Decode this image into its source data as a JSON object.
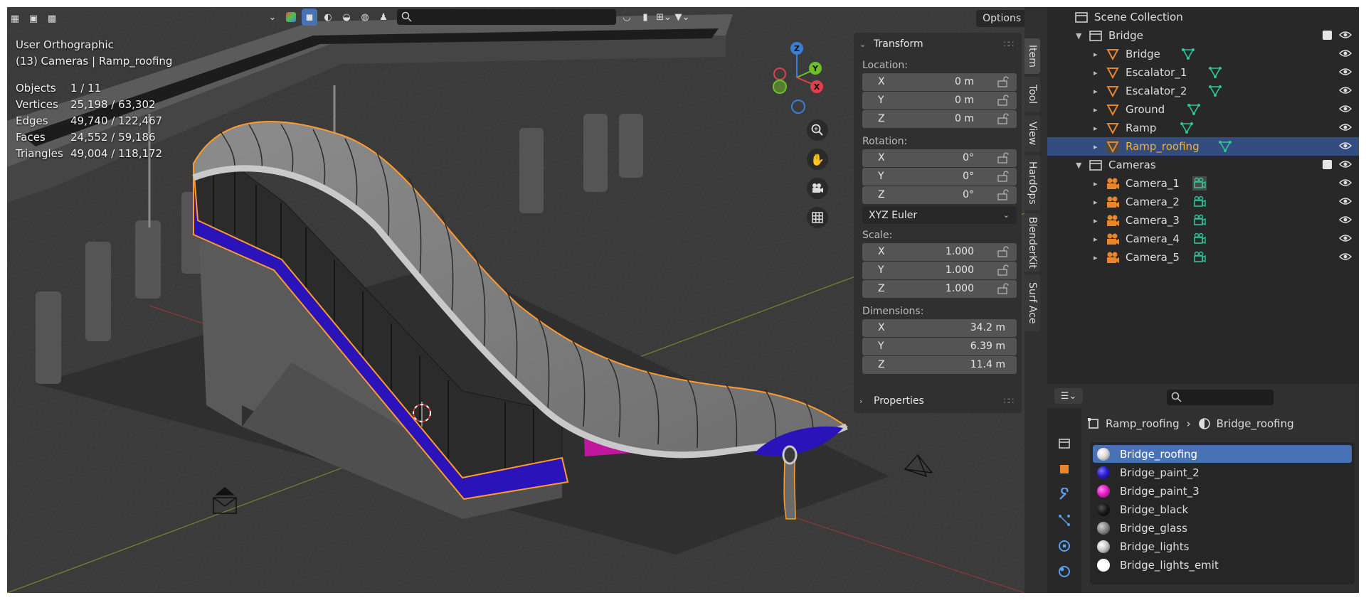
{
  "viewport": {
    "view_name": "User Orthographic",
    "context_line": "(13) Cameras | Ramp_roofing",
    "stats": [
      {
        "label": "Objects",
        "value": "1 / 11"
      },
      {
        "label": "Vertices",
        "value": "25,198 / 63,302"
      },
      {
        "label": "Edges",
        "value": "49,740 / 122,467"
      },
      {
        "label": "Faces",
        "value": "24,552 / 59,186"
      },
      {
        "label": "Triangles",
        "value": "49,004 / 118,172"
      }
    ],
    "options_label": "Options",
    "gizmo_axes": {
      "z": "Z",
      "y": "Y",
      "x": "X"
    }
  },
  "npanel": {
    "transform_header": "Transform",
    "location_label": "Location:",
    "location": [
      {
        "axis": "X",
        "value": "0 m"
      },
      {
        "axis": "Y",
        "value": "0 m"
      },
      {
        "axis": "Z",
        "value": "0 m"
      }
    ],
    "rotation_label": "Rotation:",
    "rotation": [
      {
        "axis": "X",
        "value": "0°"
      },
      {
        "axis": "Y",
        "value": "0°"
      },
      {
        "axis": "Z",
        "value": "0°"
      }
    ],
    "rotation_mode": "XYZ Euler",
    "scale_label": "Scale:",
    "scale": [
      {
        "axis": "X",
        "value": "1.000"
      },
      {
        "axis": "Y",
        "value": "1.000"
      },
      {
        "axis": "Z",
        "value": "1.000"
      }
    ],
    "dimensions_label": "Dimensions:",
    "dimensions": [
      {
        "axis": "X",
        "value": "34.2 m"
      },
      {
        "axis": "Y",
        "value": "6.39 m"
      },
      {
        "axis": "Z",
        "value": "11.4 m"
      }
    ],
    "properties_header": "Properties"
  },
  "side_tabs": [
    "Item",
    "Tool",
    "View",
    "HardOps",
    "BlenderKit",
    "Surf Ace"
  ],
  "outliner": {
    "root": "Scene Collection",
    "collections": [
      {
        "name": "Bridge",
        "objects": [
          "Bridge",
          "Escalator_1",
          "Escalator_2",
          "Ground",
          "Ramp",
          "Ramp_roofing"
        ]
      },
      {
        "name": "Cameras",
        "objects": [
          "Camera_1",
          "Camera_2",
          "Camera_3",
          "Camera_4",
          "Camera_5"
        ]
      }
    ],
    "selected": "Ramp_roofing"
  },
  "properties": {
    "breadcrumb_object": "Ramp_roofing",
    "breadcrumb_material": "Bridge_roofing",
    "materials": [
      {
        "name": "Bridge_roofing",
        "color": "#dcdcdc"
      },
      {
        "name": "Bridge_paint_2",
        "color": "#2a1fcf"
      },
      {
        "name": "Bridge_paint_3",
        "color": "#e81ec8"
      },
      {
        "name": "Bridge_black",
        "color": "#1a1a1a"
      },
      {
        "name": "Bridge_glass",
        "color": "#8a8a8a"
      },
      {
        "name": "Bridge_lights",
        "color": "#c8c8c8"
      },
      {
        "name": "Bridge_lights_emit",
        "color": "#ffffff"
      }
    ],
    "selected_material": "Bridge_roofing"
  },
  "colors": {
    "selection_outline": "#ff9a2e",
    "accent": "#4772b3",
    "outliner_selected": "#334d80",
    "mesh_icon": "#e8852f",
    "data_icon": "#2fc49a"
  }
}
